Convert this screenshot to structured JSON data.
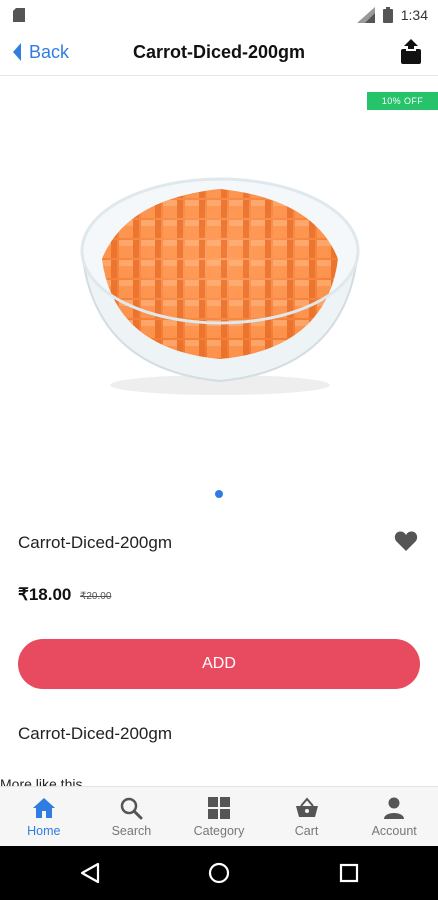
{
  "status_bar": {
    "time": "1:34"
  },
  "app_bar": {
    "back_label": "Back",
    "title": "Carrot-Diced-200gm"
  },
  "hero": {
    "discount_badge": "10% OFF",
    "slide_count": 1,
    "active_slide": 1
  },
  "product": {
    "name": "Carrot-Diced-200gm",
    "price": "₹18.00",
    "mrp": "₹20.00",
    "add_label": "ADD",
    "description": "Carrot-Diced-200gm",
    "more_heading": "More like this"
  },
  "bottom_nav": {
    "items": [
      {
        "label": "Home",
        "icon": "home-icon",
        "active": true
      },
      {
        "label": "Search",
        "icon": "search-icon",
        "active": false
      },
      {
        "label": "Category",
        "icon": "grid-icon",
        "active": false
      },
      {
        "label": "Cart",
        "icon": "basket-icon",
        "active": false
      },
      {
        "label": "Account",
        "icon": "person-icon",
        "active": false
      }
    ]
  },
  "colors": {
    "accent": "#2f7de1",
    "add_button": "#e84a5f",
    "discount_badge": "#27c36a",
    "icon_grey": "#555555"
  }
}
